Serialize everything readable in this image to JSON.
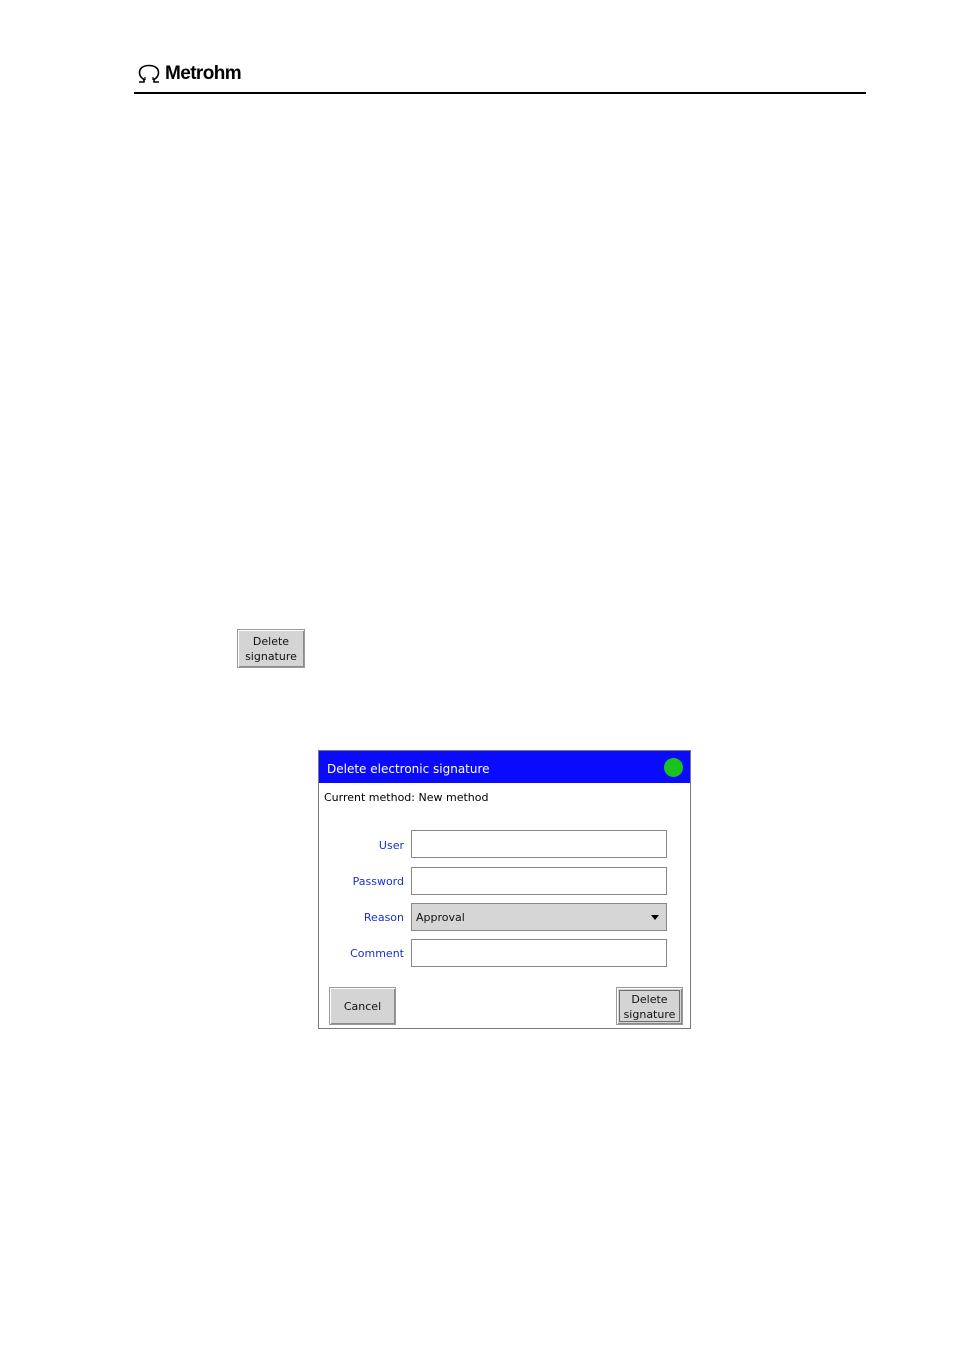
{
  "header": {
    "brand": "Metrohm"
  },
  "side_button": {
    "line1": "Delete",
    "line2": "signature"
  },
  "dialog": {
    "title": "Delete electronic signature",
    "status_color": "#1cc21c",
    "current_method": "Current method: New method",
    "fields": {
      "user": {
        "label": "User",
        "value": ""
      },
      "password": {
        "label": "Password",
        "value": ""
      },
      "reason": {
        "label": "Reason",
        "value": "Approval"
      },
      "comment": {
        "label": "Comment",
        "value": ""
      }
    },
    "buttons": {
      "cancel": "Cancel",
      "delete_line1": "Delete",
      "delete_line2": "signature"
    }
  },
  "colors": {
    "titlebar": "#0a0aff",
    "label": "#1a2fd6",
    "button_face": "#d4d4d4"
  }
}
